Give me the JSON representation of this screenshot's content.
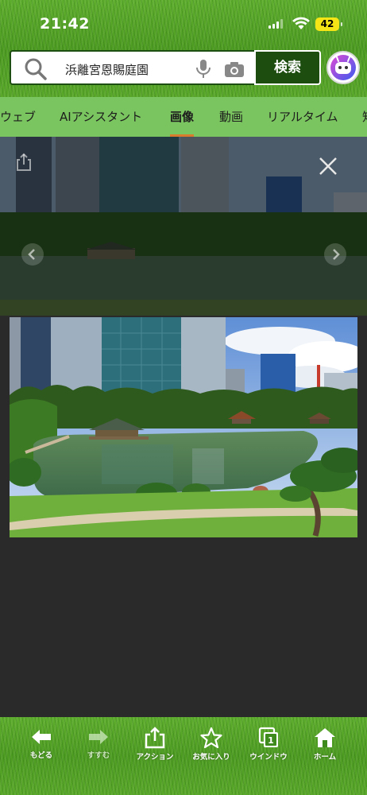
{
  "status_bar": {
    "time": "21:42",
    "battery": "42",
    "battery_color": "#f6e516"
  },
  "search": {
    "query": "浜離宮恩賜庭園",
    "button_label": "検索",
    "icons": [
      "search-icon",
      "mic-icon",
      "camera-icon"
    ]
  },
  "tabs": [
    {
      "label": "ウェブ",
      "active": false
    },
    {
      "label": "AIアシスタント",
      "active": false
    },
    {
      "label": "画像",
      "active": true
    },
    {
      "label": "動画",
      "active": false
    },
    {
      "label": "リアルタイム",
      "active": false
    },
    {
      "label": "知",
      "active": false
    }
  ],
  "viewer": {
    "icons": [
      "share-icon",
      "close-icon",
      "chevron-left-icon",
      "chevron-right-icon"
    ]
  },
  "toolbar": {
    "items": [
      {
        "label": "もどる",
        "icon": "back-arrow-icon",
        "enabled": true
      },
      {
        "label": "すすむ",
        "icon": "forward-arrow-icon",
        "enabled": false
      },
      {
        "label": "アクション",
        "icon": "share-icon",
        "enabled": true
      },
      {
        "label": "お気に入り",
        "icon": "star-icon",
        "enabled": true
      },
      {
        "label": "ウインドウ",
        "icon": "windows-icon",
        "badge": "1",
        "enabled": true
      },
      {
        "label": "ホーム",
        "icon": "home-icon",
        "enabled": true
      }
    ]
  },
  "colors": {
    "header_green": "#4e9c22",
    "tab_bar": "#7ac55f",
    "search_button": "#1e4d10",
    "active_tab_underline": "#d97a2d",
    "viewer_background": "#2a2a2a"
  }
}
